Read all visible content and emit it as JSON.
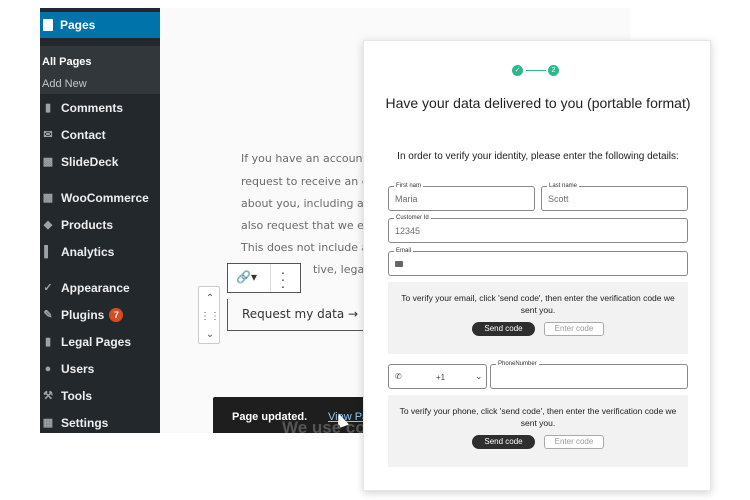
{
  "wp": {
    "sidebar": {
      "current": "Pages",
      "submenu": [
        "All Pages",
        "Add New"
      ],
      "items": [
        {
          "label": "Comments",
          "icon": "comments-icon"
        },
        {
          "label": "Contact",
          "icon": "mail-icon"
        },
        {
          "label": "SlideDeck",
          "icon": "slidedeck-icon"
        },
        {
          "label": "WooCommerce",
          "icon": "woocommerce-icon"
        },
        {
          "label": "Products",
          "icon": "products-icon"
        },
        {
          "label": "Analytics",
          "icon": "analytics-icon"
        },
        {
          "label": "Appearance",
          "icon": "appearance-icon"
        },
        {
          "label": "Plugins",
          "icon": "plugins-icon",
          "badge": "7"
        },
        {
          "label": "Legal Pages",
          "icon": "legal-pages-icon"
        },
        {
          "label": "Users",
          "icon": "users-icon"
        },
        {
          "label": "Tools",
          "icon": "tools-icon"
        },
        {
          "label": "Settings",
          "icon": "settings-icon"
        }
      ]
    },
    "paragraph": [
      "If you have an account",
      "request to receive an e",
      "about you, including a",
      "also request that we e",
      "This does not include a",
      "tive, legal, o"
    ],
    "button_label": "Request my data →",
    "snackbar": {
      "text": "Page updated.",
      "link": "View Page"
    },
    "background_heading": "We use cook"
  },
  "form": {
    "steps": [
      "",
      "2"
    ],
    "title": "Have your data delivered to you (portable format)",
    "intro": "In order to verify your identity, please enter the following details:",
    "first_name": {
      "label": "First nam",
      "value": "Maria"
    },
    "last_name": {
      "label": "Last name",
      "value": "Scott"
    },
    "customer_id": {
      "label": "Customer Id",
      "value": "12345"
    },
    "email": {
      "label": "Email",
      "value": ""
    },
    "email_verify": {
      "text": "To verify your email, click 'send code', then enter the verification code we sent you.",
      "send": "Send code",
      "placeholder": "Enter code"
    },
    "phone_prefix": "+1",
    "phone": {
      "label": "PhoneNumber",
      "value": ""
    },
    "phone_verify": {
      "text": "To verify your phone, click 'send code', then enter the verification code we sent you.",
      "send": "Send code",
      "placeholder": "Enter code"
    }
  }
}
